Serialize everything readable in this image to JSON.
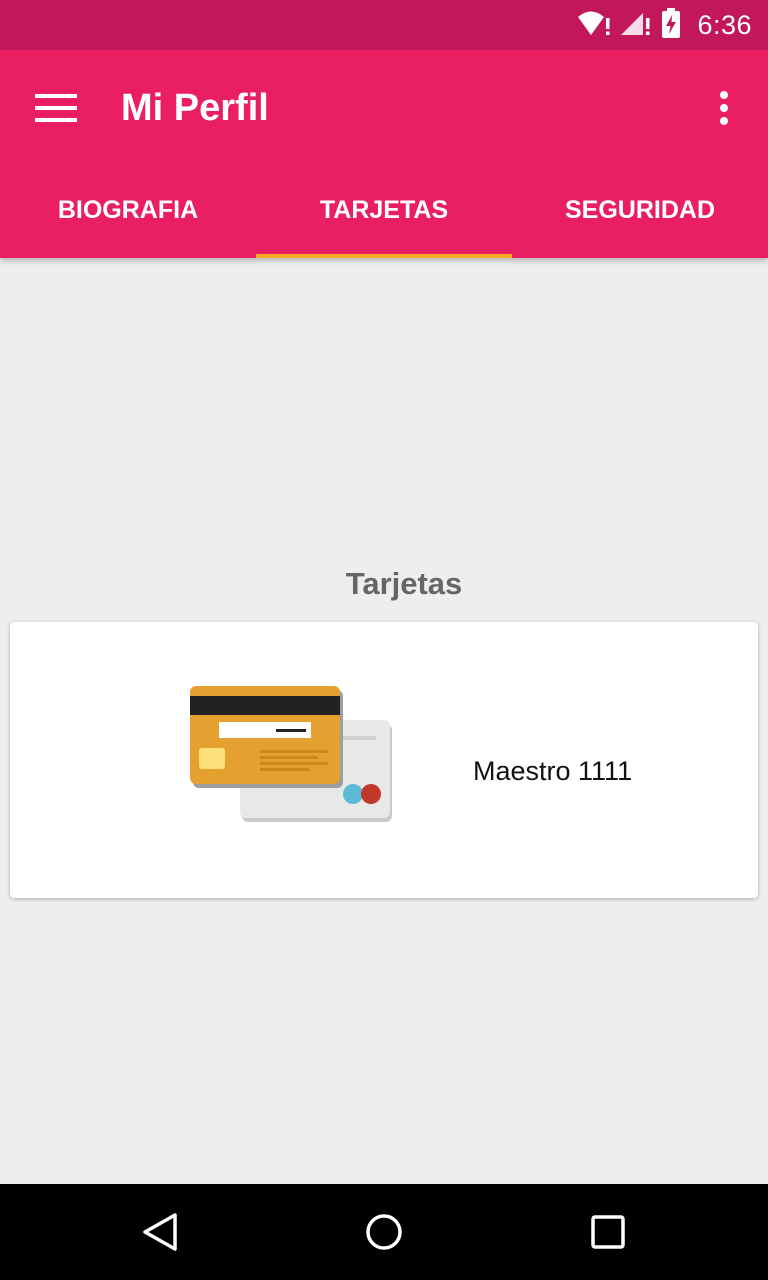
{
  "status_bar": {
    "time": "6:36",
    "icons": [
      "wifi-alert-icon",
      "signal-alert-icon",
      "battery-charging-icon"
    ]
  },
  "app_bar": {
    "menu_icon": "menu-icon",
    "title": "Mi Perfil",
    "overflow_icon": "more-vert-icon"
  },
  "tabs": [
    {
      "label": "BIOGRAFIA",
      "active": false
    },
    {
      "label": "TARJETAS",
      "active": true
    },
    {
      "label": "SEGURIDAD",
      "active": false
    }
  ],
  "section": {
    "title": "Tarjetas"
  },
  "cards": [
    {
      "label": "Maestro 1111",
      "icon": "credit-card-icon"
    }
  ],
  "nav_bar": {
    "buttons": [
      "back-icon",
      "home-icon",
      "recents-icon"
    ]
  },
  "colors": {
    "status_bar": "#c2185b",
    "primary": "#e91e63",
    "tab_indicator": "#ffa726",
    "background": "#eeeeee",
    "card_front": "#e5a12f",
    "card_back": "#e8e8e8"
  }
}
